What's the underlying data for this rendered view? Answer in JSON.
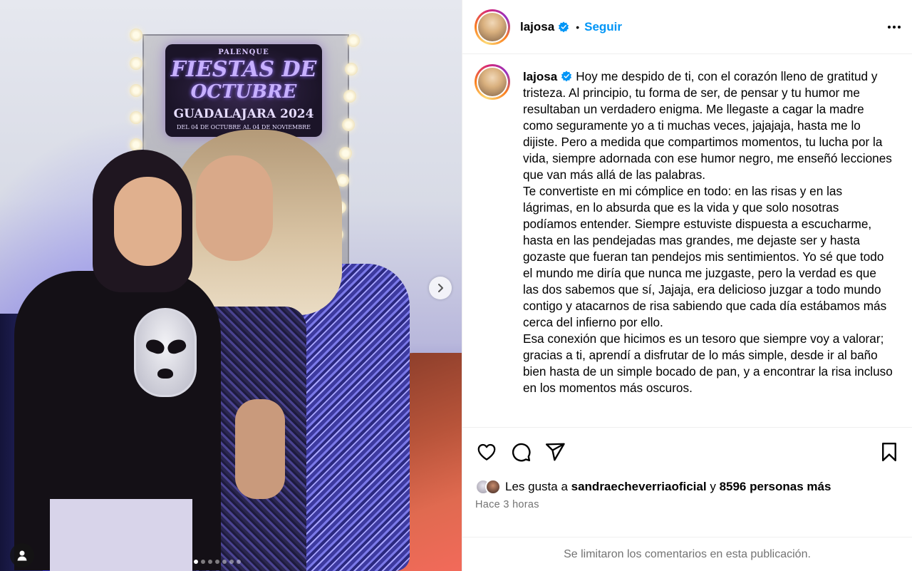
{
  "post": {
    "username": "lajosa",
    "follow_label": "Seguir",
    "separator": "•",
    "photo_sign": {
      "line1": "PALENQUE",
      "line2": "FIESTAS DE",
      "line3": "OCTUBRE",
      "line4": "GUADALAJARA 2024",
      "line5": "DEL 04 DE OCTUBRE AL 04 DE NOVIEMBRE"
    },
    "carousel": {
      "count": 7,
      "active_index": 0
    }
  },
  "caption": {
    "username": "lajosa",
    "paragraphs": [
      "Hoy me despido de ti, con el corazón lleno de gratitud y tristeza. Al principio, tu forma de ser, de pensar y tu humor me resultaban un verdadero enigma. Me llegaste a cagar la madre como seguramente yo a ti muchas veces, jajajaja, hasta me lo dijiste. Pero a medida que compartimos momentos, tu lucha por la vida, siempre adornada con ese humor negro, me enseñó lecciones que van más allá de las palabras.",
      "Te convertiste en mi cómplice en todo: en las risas y en las lágrimas, en lo absurda que es la vida y que solo nosotras podíamos entender. Siempre estuviste dispuesta a escucharme, hasta en las pendejadas mas grandes, me dejaste ser y hasta gozaste que fueran tan pendejos mis sentimientos. Yo sé que todo el mundo me diría que nunca me juzgaste, pero la verdad es que las dos sabemos que sí, Jajaja, era delicioso juzgar a todo mundo contigo y atacarnos de risa sabiendo que cada día estábamos más cerca del infierno por ello.",
      "Esa conexión que hicimos es un tesoro que siempre voy a valorar; gracias a ti, aprendí a disfrutar de lo más simple, desde ir al baño bien hasta de un simple bocado de pan, y a encontrar la risa incluso en los momentos más oscuros."
    ]
  },
  "likes": {
    "prefix": "Les gusta a",
    "liker": "sandraecheverriaoficial",
    "joiner": "y",
    "others": "8596 personas más"
  },
  "timestamp": "Hace 3 horas",
  "comments_notice": "Se limitaron los comentarios en esta publicación.",
  "colors": {
    "accent": "#0095f6",
    "verified": "#0095f6",
    "muted": "#737373"
  }
}
